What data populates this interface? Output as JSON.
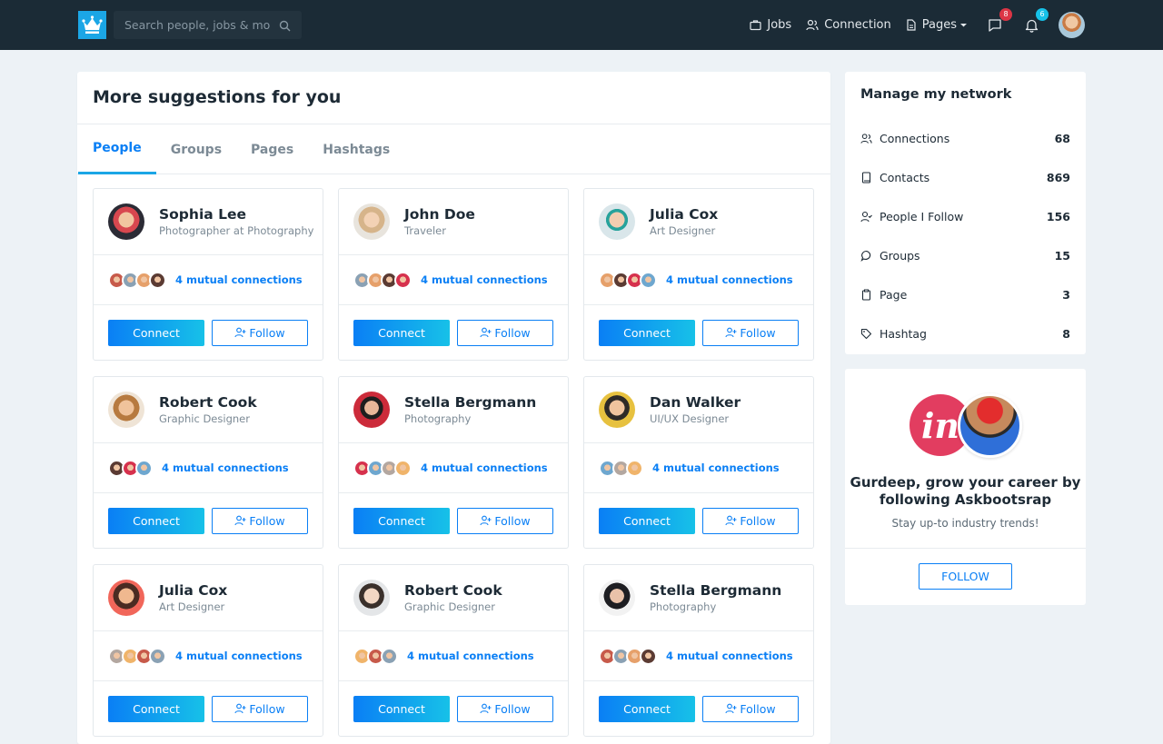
{
  "nav": {
    "search_placeholder": "Search people, jobs & more...",
    "links": [
      "Jobs",
      "Connection",
      "Pages"
    ],
    "messages_badge": "8",
    "notifications_badge": "6"
  },
  "main": {
    "title": "More suggestions for you",
    "tabs": [
      "People",
      "Groups",
      "Pages",
      "Hashtags"
    ],
    "cards": [
      {
        "name": "Sophia Lee",
        "role": "Photographer at Photography",
        "mutual": "4 mutual connections",
        "connect": "Connect",
        "follow": "Follow"
      },
      {
        "name": "John Doe",
        "role": "Traveler",
        "mutual": "4 mutual connections",
        "connect": "Connect",
        "follow": "Follow"
      },
      {
        "name": "Julia Cox",
        "role": "Art Designer",
        "mutual": "4 mutual connections",
        "connect": "Connect",
        "follow": "Follow"
      },
      {
        "name": "Robert Cook",
        "role": "Graphic Designer",
        "mutual": "4 mutual connections",
        "connect": "Connect",
        "follow": "Follow"
      },
      {
        "name": "Stella Bergmann",
        "role": "Photography",
        "mutual": "4 mutual connections",
        "connect": "Connect",
        "follow": "Follow"
      },
      {
        "name": "Dan Walker",
        "role": "UI/UX Designer",
        "mutual": "4 mutual connections",
        "connect": "Connect",
        "follow": "Follow"
      },
      {
        "name": "Julia Cox",
        "role": "Art Designer",
        "mutual": "4 mutual connections",
        "connect": "Connect",
        "follow": "Follow"
      },
      {
        "name": "Robert Cook",
        "role": "Graphic Designer",
        "mutual": "4 mutual connections",
        "connect": "Connect",
        "follow": "Follow"
      },
      {
        "name": "Stella Bergmann",
        "role": "Photography",
        "mutual": "4 mutual connections",
        "connect": "Connect",
        "follow": "Follow"
      }
    ]
  },
  "network": {
    "title": "Manage my network",
    "items": [
      {
        "label": "Connections",
        "count": "68"
      },
      {
        "label": "Contacts",
        "count": "869"
      },
      {
        "label": "People I Follow",
        "count": "156"
      },
      {
        "label": "Groups",
        "count": "15"
      },
      {
        "label": "Page",
        "count": "3"
      },
      {
        "label": "Hashtag",
        "count": "8"
      }
    ]
  },
  "promo": {
    "logo_text": "in",
    "text_line1": "Gurdeep, grow your career by",
    "text_line2": "following Askbootsrap",
    "subtext": "Stay up-to industry trends!",
    "button": "FOLLOW"
  },
  "colors": {
    "navbar": "#1b2b36",
    "primary": "#0a7ff5",
    "accent": "#17c1e8",
    "logo_bg": "#1ba6e6",
    "promo_brand": "#e23d60"
  }
}
